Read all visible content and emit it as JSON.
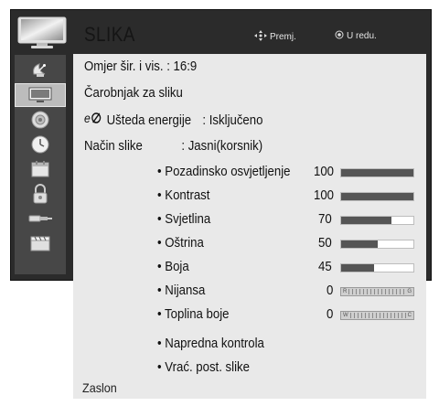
{
  "header": {
    "title": "SLIKA",
    "hint_move": "Premj.",
    "hint_ok": "U redu."
  },
  "sidebar": {
    "items": [
      {
        "icon": "satellite-dish-icon",
        "selected": false
      },
      {
        "icon": "tv-screen-icon",
        "selected": true
      },
      {
        "icon": "speaker-icon",
        "selected": false
      },
      {
        "icon": "clock-icon",
        "selected": false
      },
      {
        "icon": "calendar-icon",
        "selected": false
      },
      {
        "icon": "lock-icon",
        "selected": false
      },
      {
        "icon": "input-plug-icon",
        "selected": false
      },
      {
        "icon": "clapperboard-icon",
        "selected": false
      }
    ]
  },
  "menu": {
    "aspect_ratio": "Omjer šir. i vis. : 16:9",
    "picture_wizard": "Čarobnjak za sliku",
    "energy_saving_label": "Ušteda energije",
    "energy_saving_value": ": Isključeno",
    "picture_mode_label": "Način slike",
    "picture_mode_value": ": Jasni(korsnik)",
    "settings": [
      {
        "label": "• Pozadinsko osvjetljenje",
        "value": "100",
        "level": 1.0,
        "kind": "bar"
      },
      {
        "label": "• Kontrast",
        "value": "100",
        "level": 1.0,
        "kind": "bar"
      },
      {
        "label": "• Svjetlina",
        "value": "70",
        "level": 0.7,
        "kind": "bar"
      },
      {
        "label": "• Oštrina",
        "value": "50",
        "level": 0.5,
        "kind": "bar"
      },
      {
        "label": "• Boja",
        "value": "45",
        "level": 0.45,
        "kind": "bar"
      },
      {
        "label": "• Nijansa",
        "value": "0",
        "kind": "scale",
        "left": "R",
        "right": "G"
      },
      {
        "label": "• Toplina boje",
        "value": "0",
        "kind": "scale",
        "left": "W",
        "right": "C"
      }
    ],
    "advanced": "• Napredna kontrola",
    "reset": "• Vrać. post. slike"
  },
  "footer": {
    "label": "Zaslon"
  },
  "colors": {
    "panel": "#2b2b2b",
    "sidebar": "#474747",
    "menu_bg": "#e9e9e9",
    "bar_fill": "#555555"
  }
}
